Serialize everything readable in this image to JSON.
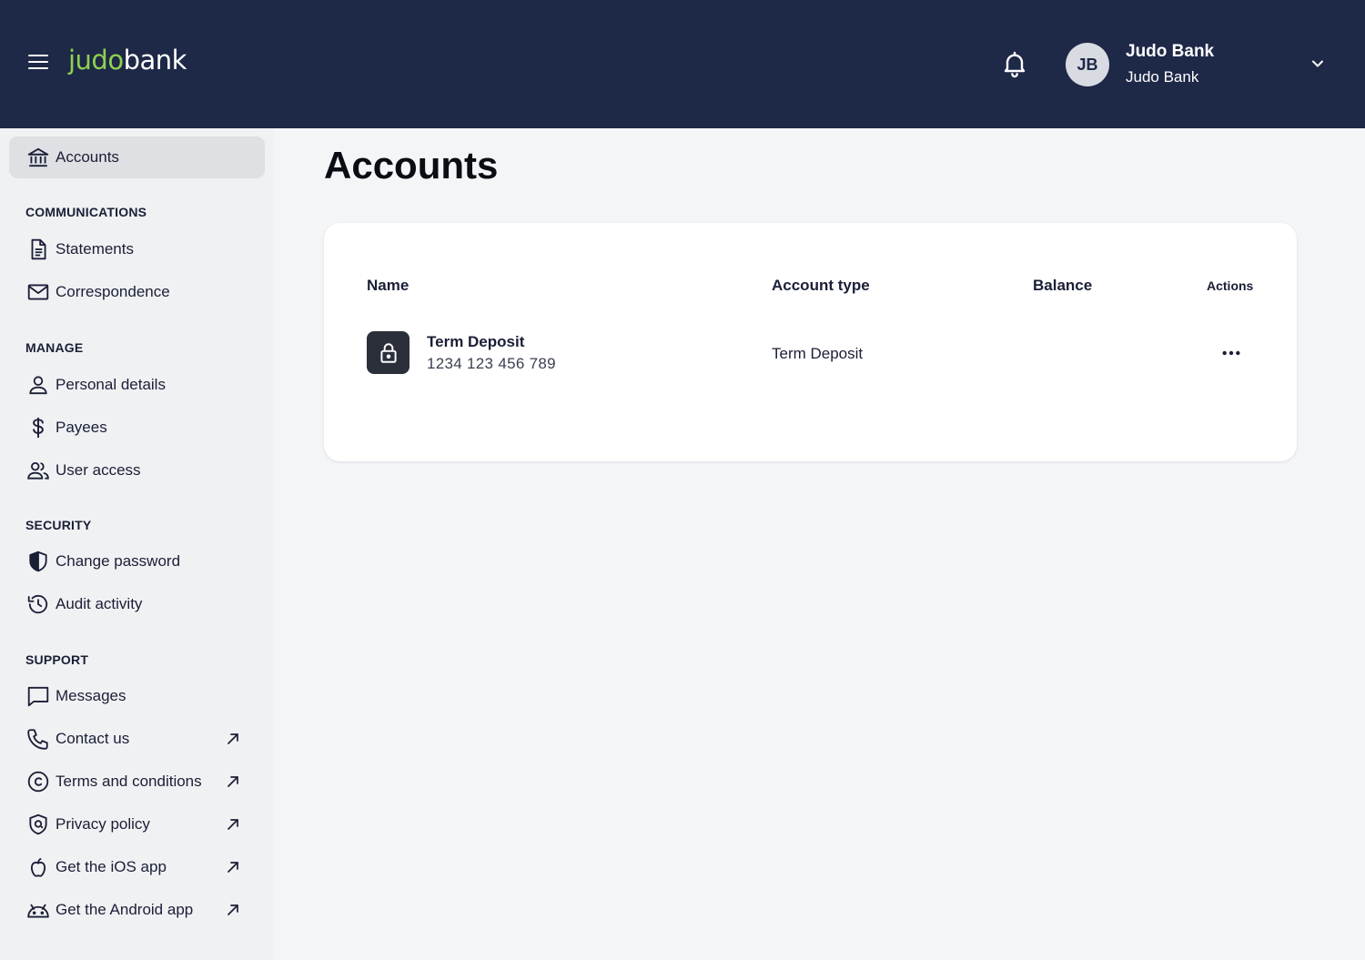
{
  "header": {
    "logo_part1": "judo",
    "logo_part2": "bank",
    "user_initials": "JB",
    "user_name": "Judo Bank",
    "user_org": "Judo Bank"
  },
  "sidebar": {
    "accounts_label": "Accounts",
    "sections": {
      "communications": "COMMUNICATIONS",
      "manage": "MANAGE",
      "security": "SECURITY",
      "support": "SUPPORT"
    },
    "items": {
      "statements": "Statements",
      "correspondence": "Correspondence",
      "personal_details": "Personal details",
      "payees": "Payees",
      "user_access": "User access",
      "change_password": "Change password",
      "audit_activity": "Audit activity",
      "messages": "Messages",
      "contact_us": "Contact us",
      "terms": "Terms and conditions",
      "privacy": "Privacy policy",
      "ios_app": "Get the iOS app",
      "android_app": "Get the Android app"
    }
  },
  "main": {
    "title": "Accounts",
    "table": {
      "columns": [
        "Name",
        "Account type",
        "Balance",
        "Actions"
      ],
      "rows": [
        {
          "name": "Term Deposit",
          "number": "1234 123 456 789",
          "type": "Term Deposit",
          "balance": ""
        }
      ]
    }
  },
  "colors": {
    "header_bg": "#1e2847",
    "logo_accent": "#8fd14f",
    "page_bg": "#f4f5f7",
    "active_nav": "#dfe0e4"
  }
}
